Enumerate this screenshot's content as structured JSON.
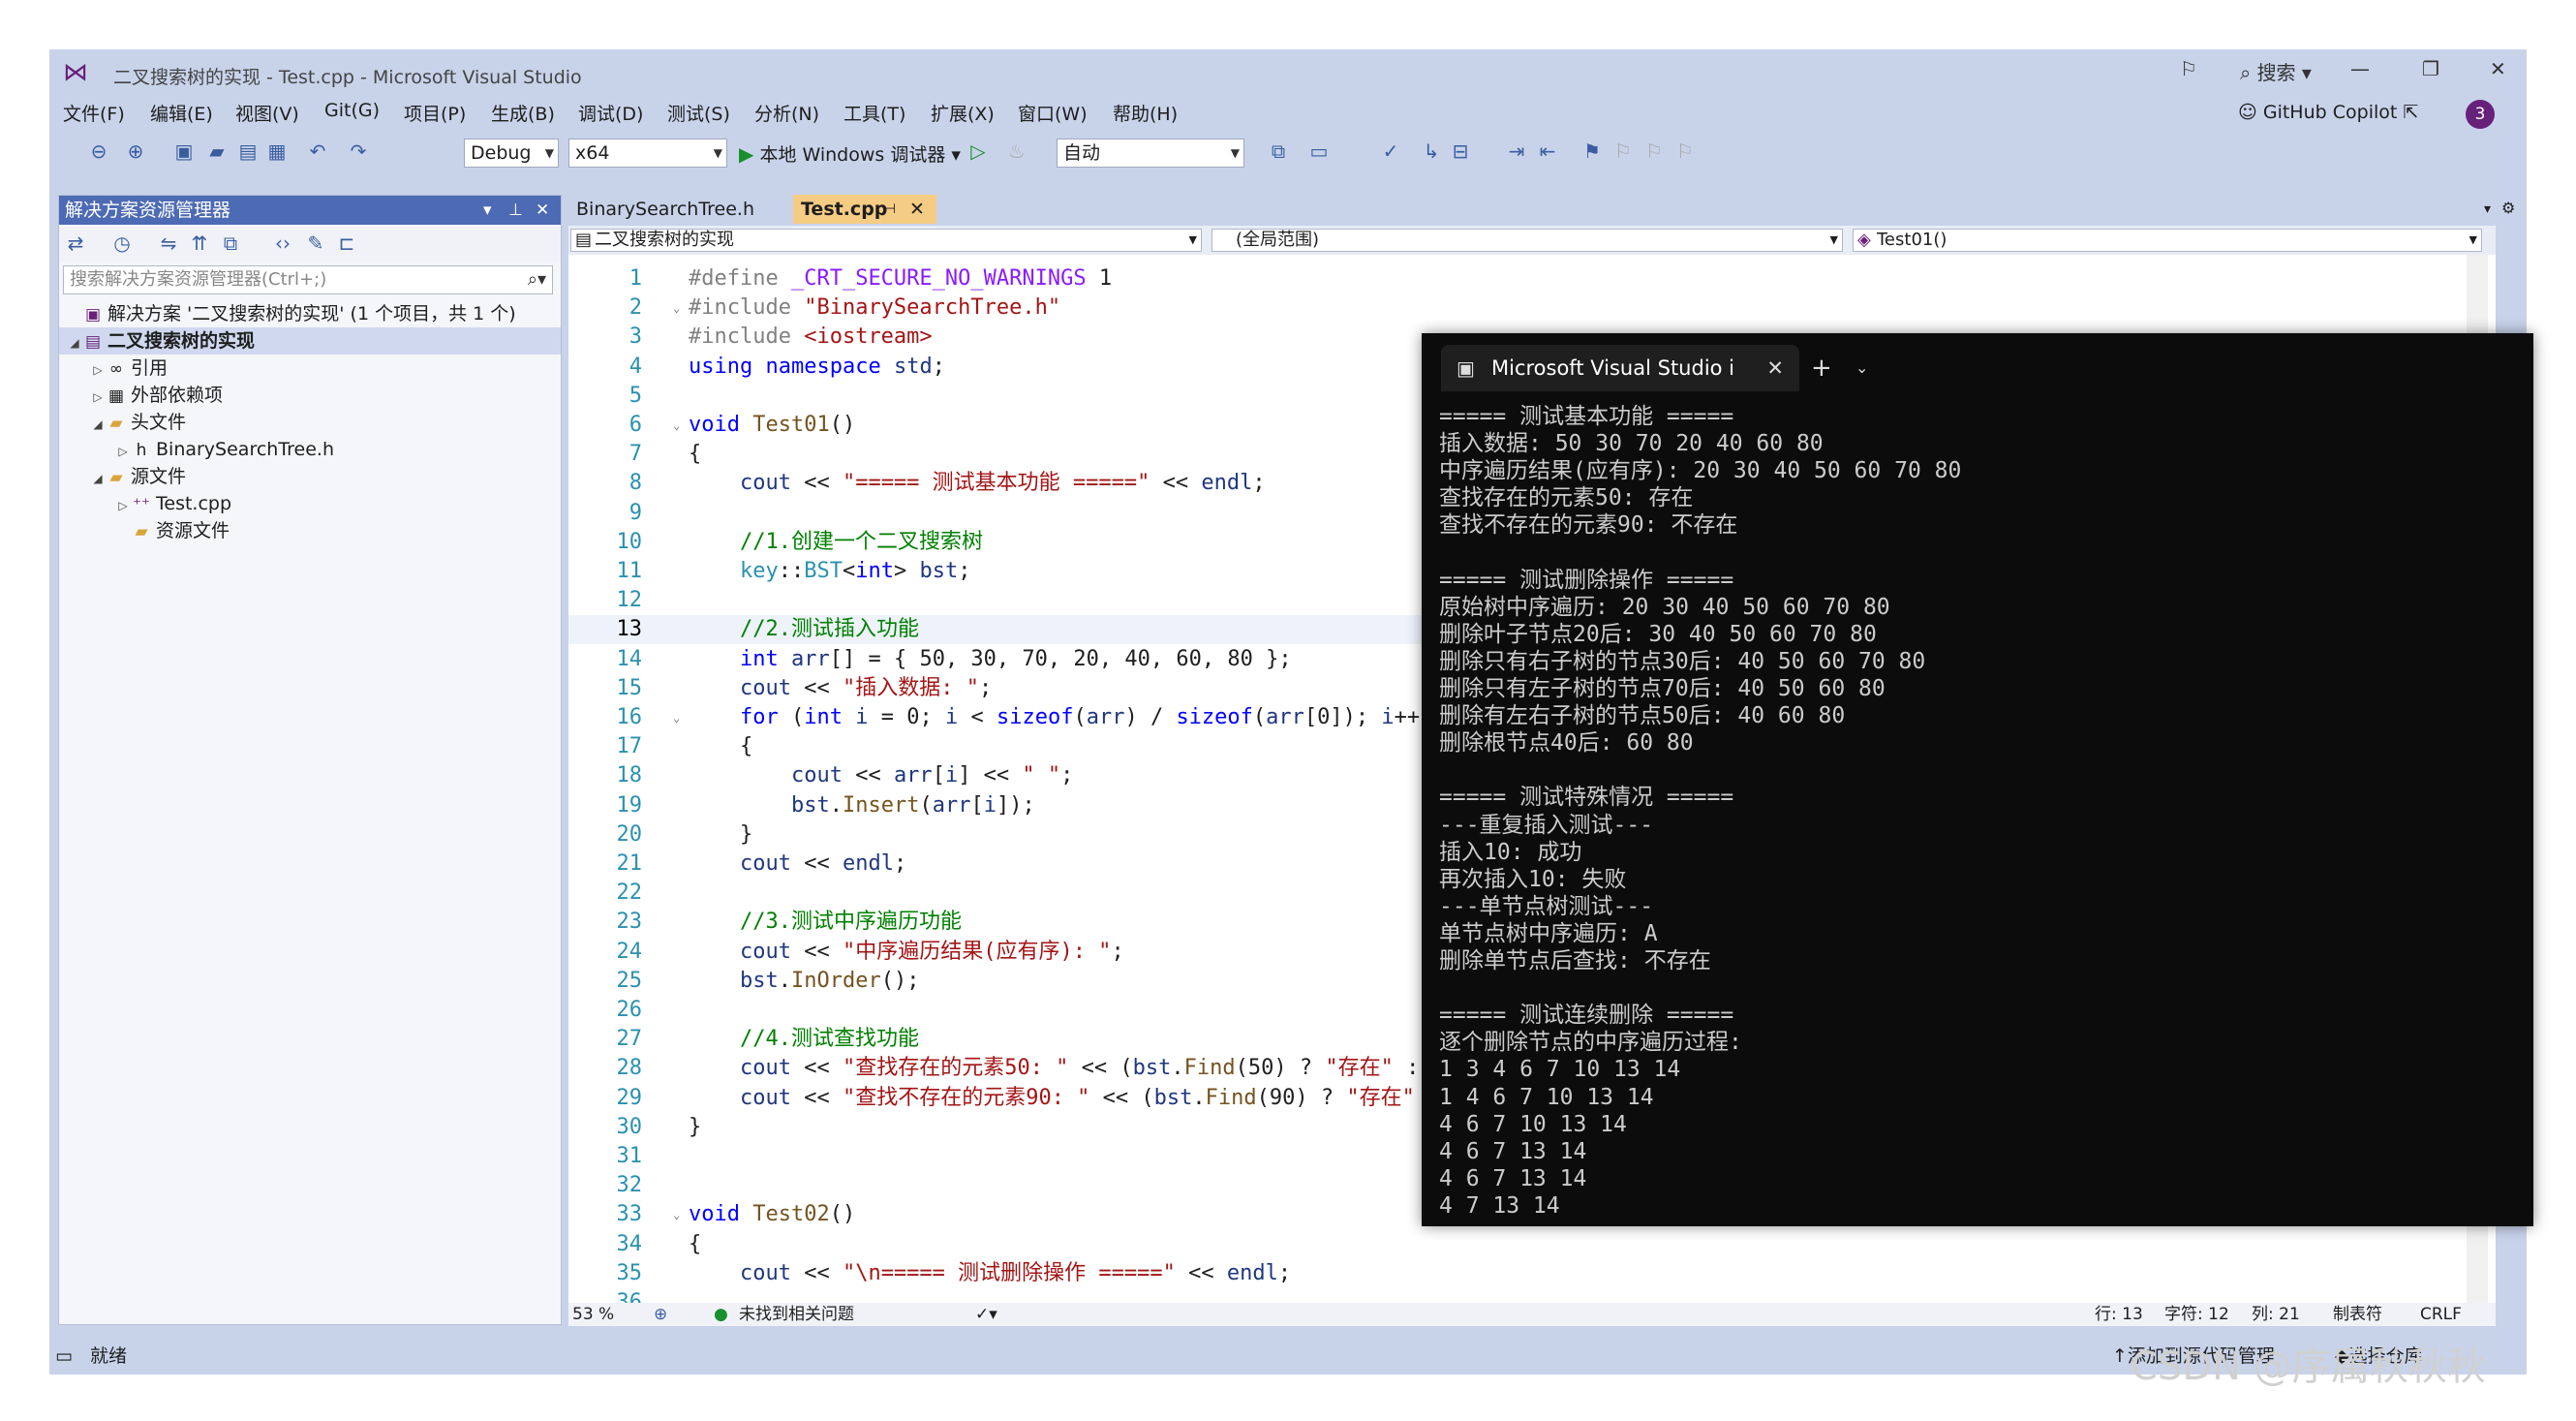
{
  "window": {
    "title": "二叉搜索树的实现 - Test.cpp - Microsoft Visual Studio",
    "search_label": "搜索",
    "copilot_label": "GitHub Copilot",
    "notif_count": "3"
  },
  "menu": [
    "文件(F)",
    "编辑(E)",
    "视图(V)",
    "Git(G)",
    "项目(P)",
    "生成(B)",
    "调试(D)",
    "测试(S)",
    "分析(N)",
    "工具(T)",
    "扩展(X)",
    "窗口(W)",
    "帮助(H)"
  ],
  "toolbar": {
    "config": "Debug",
    "platform": "x64",
    "run_label": "本地 Windows 调试器",
    "auto": "自动"
  },
  "solution_explorer": {
    "header": "解决方案资源管理器",
    "search_placeholder": "搜索解决方案资源管理器(Ctrl+;)",
    "items": [
      {
        "label": "解决方案 '二叉搜索树的实现' (1 个项目，共 1 个)"
      },
      {
        "label": "二叉搜索树的实现"
      },
      {
        "label": "引用"
      },
      {
        "label": "外部依赖项"
      },
      {
        "label": "头文件"
      },
      {
        "label": "BinarySearchTree.h"
      },
      {
        "label": "源文件"
      },
      {
        "label": "Test.cpp"
      },
      {
        "label": "资源文件"
      }
    ]
  },
  "editor": {
    "tabs": [
      "BinarySearchTree.h",
      "Test.cpp"
    ],
    "nav_project": "二叉搜索树的实现",
    "nav_scope": "(全局范围)",
    "nav_member": "Test01()",
    "zoom": "53 %",
    "issues": "未找到相关问题",
    "line": "行: 13",
    "char": "字符: 12",
    "col": "列: 21",
    "tabs_mode": "制表符",
    "eol": "CRLF"
  },
  "code_lines": [
    {
      "n": "1",
      "t": "#define _CRT_SECURE_NO_WARNINGS 1"
    },
    {
      "n": "2",
      "t": "#include \"BinarySearchTree.h\""
    },
    {
      "n": "3",
      "t": "#include <iostream>"
    },
    {
      "n": "4",
      "t": "using namespace std;"
    },
    {
      "n": "5",
      "t": ""
    },
    {
      "n": "6",
      "t": "void Test01()"
    },
    {
      "n": "7",
      "t": "{"
    },
    {
      "n": "8",
      "t": "    cout << \"===== 测试基本功能 =====\" << endl;"
    },
    {
      "n": "9",
      "t": ""
    },
    {
      "n": "10",
      "t": "    //1.创建一个二叉搜索树"
    },
    {
      "n": "11",
      "t": "    key::BST<int> bst;"
    },
    {
      "n": "12",
      "t": ""
    },
    {
      "n": "13",
      "t": "    //2.测试插入功能"
    },
    {
      "n": "14",
      "t": "    int arr[] = { 50, 30, 70, 20, 40, 60, 80 };"
    },
    {
      "n": "15",
      "t": "    cout << \"插入数据: \";"
    },
    {
      "n": "16",
      "t": "    for (int i = 0; i < sizeof(arr) / sizeof(arr[0]); i++)"
    },
    {
      "n": "17",
      "t": "    {"
    },
    {
      "n": "18",
      "t": "        cout << arr[i] << \" \";"
    },
    {
      "n": "19",
      "t": "        bst.Insert(arr[i]);"
    },
    {
      "n": "20",
      "t": "    }"
    },
    {
      "n": "21",
      "t": "    cout << endl;"
    },
    {
      "n": "22",
      "t": ""
    },
    {
      "n": "23",
      "t": "    //3.测试中序遍历功能"
    },
    {
      "n": "24",
      "t": "    cout << \"中序遍历结果(应有序): \";"
    },
    {
      "n": "25",
      "t": "    bst.InOrder();"
    },
    {
      "n": "26",
      "t": ""
    },
    {
      "n": "27",
      "t": "    //4.测试查找功能"
    },
    {
      "n": "28",
      "t": "    cout << \"查找存在的元素50: \" << (bst.Find(50) ? \"存在\" :"
    },
    {
      "n": "29",
      "t": "    cout << \"查找不存在的元素90: \" << (bst.Find(90) ? \"存在\""
    },
    {
      "n": "30",
      "t": "}"
    },
    {
      "n": "31",
      "t": ""
    },
    {
      "n": "32",
      "t": ""
    },
    {
      "n": "33",
      "t": "void Test02()"
    },
    {
      "n": "34",
      "t": "{"
    },
    {
      "n": "35",
      "t": "    cout << \"\\n===== 测试删除操作 =====\" << endl;"
    },
    {
      "n": "36",
      "t": ""
    }
  ],
  "terminal": {
    "tab_title": "Microsoft Visual Studio i",
    "lines": [
      "===== 测试基本功能 =====",
      "插入数据: 50 30 70 20 40 60 80",
      "中序遍历结果(应有序): 20 30 40 50 60 70 80",
      "查找存在的元素50: 存在",
      "查找不存在的元素90: 不存在",
      "",
      "===== 测试删除操作 =====",
      "原始树中序遍历: 20 30 40 50 60 70 80",
      "删除叶子节点20后: 30 40 50 60 70 80",
      "删除只有右子树的节点30后: 40 50 60 70 80",
      "删除只有左子树的节点70后: 40 50 60 80",
      "删除有左右子树的节点50后: 40 60 80",
      "删除根节点40后: 60 80",
      "",
      "===== 测试特殊情况 =====",
      "---重复插入测试---",
      "插入10: 成功",
      "再次插入10: 失败",
      "---单节点树测试---",
      "单节点树中序遍历: A",
      "删除单节点后查找: 不存在",
      "",
      "===== 测试连续删除 =====",
      "逐个删除节点的中序遍历过程:",
      "1 3 4 6 7 10 13 14",
      "1 4 6 7 10 13 14",
      "4 6 7 10 13 14",
      "4 6 7 13 14",
      "4 6 7 13 14",
      "4 7 13 14"
    ]
  },
  "statusbar": {
    "ready": "就绪",
    "add_source": "添加到源代码管理",
    "select_repo": "选择仓库"
  },
  "watermark": "CSDN @序属秋秋秋"
}
